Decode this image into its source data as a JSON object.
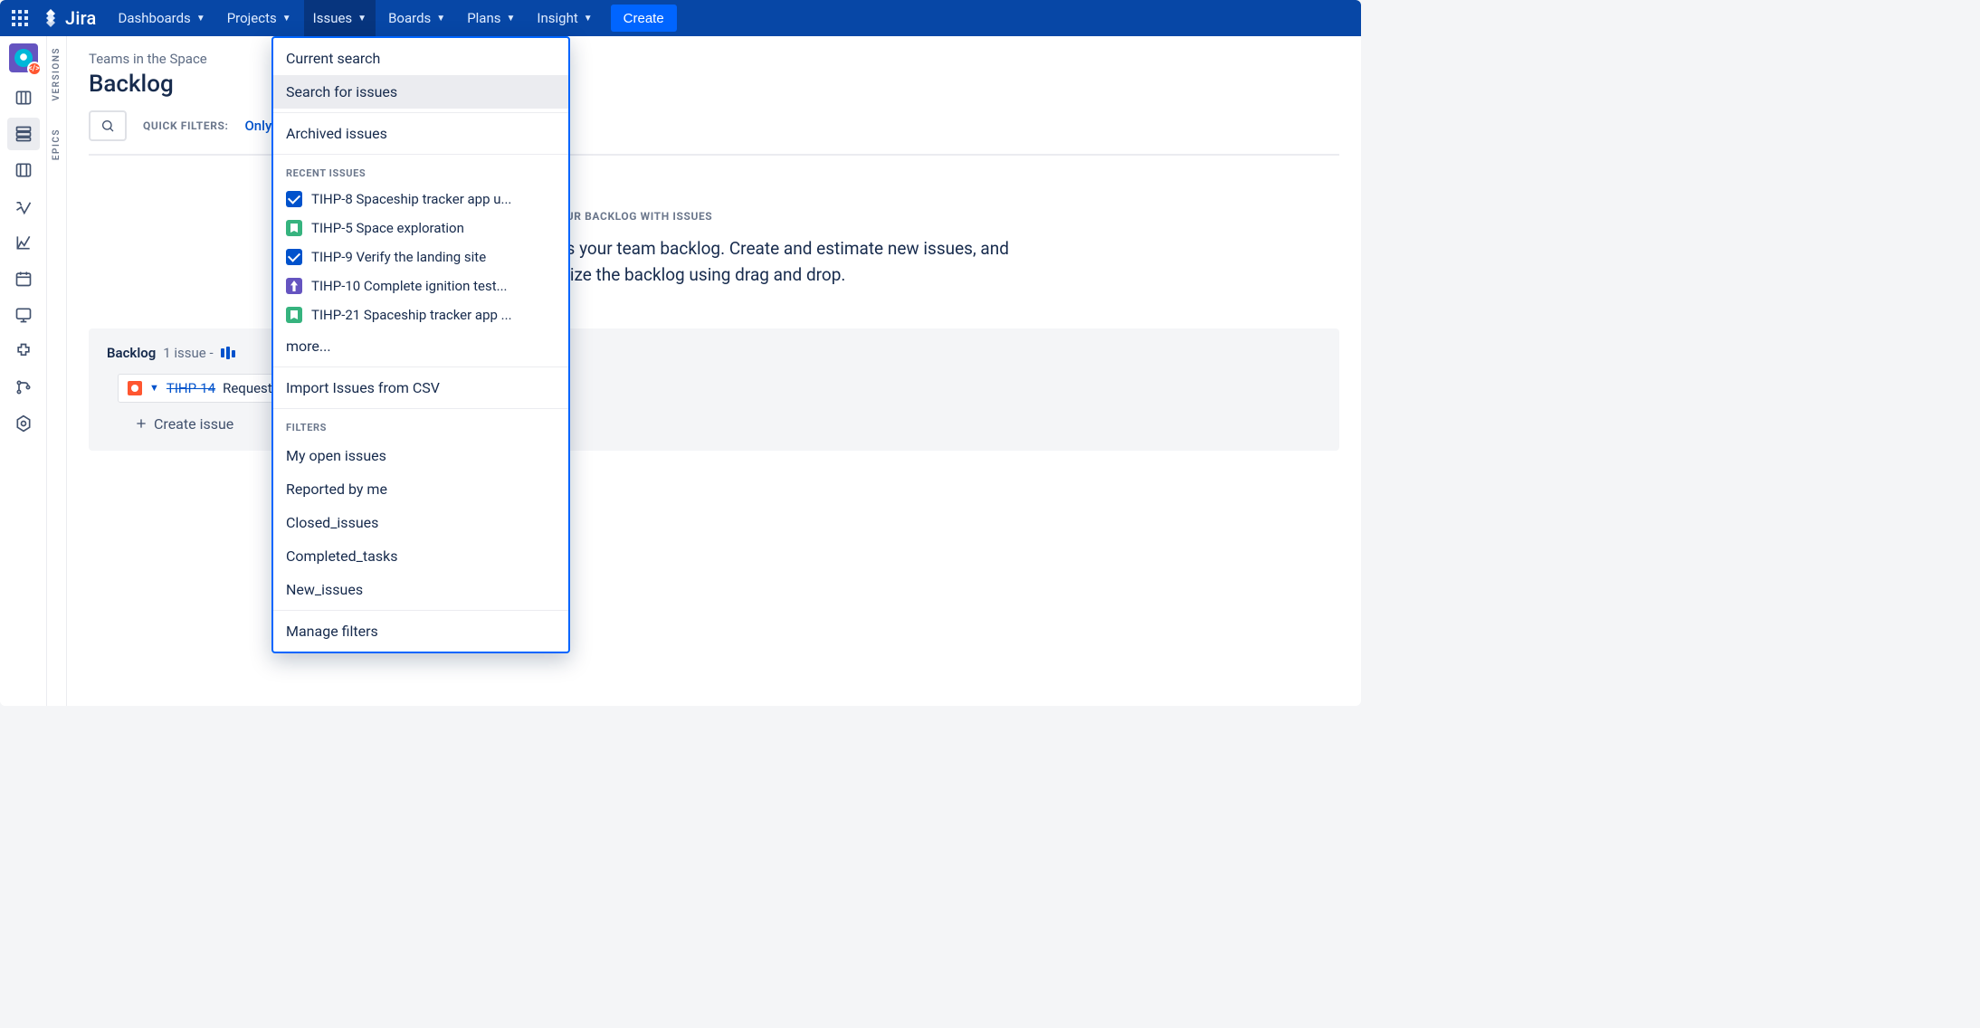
{
  "brand": {
    "name": "Jira"
  },
  "topnav": {
    "items": [
      {
        "label": "Dashboards"
      },
      {
        "label": "Projects"
      },
      {
        "label": "Issues",
        "active": true
      },
      {
        "label": "Boards"
      },
      {
        "label": "Plans"
      },
      {
        "label": "Insight"
      }
    ],
    "create_label": "Create"
  },
  "side_rails": {
    "versions": "VERSIONS",
    "epics": "EPICS"
  },
  "header": {
    "breadcrumb": "Teams in the Space",
    "title": "Backlog",
    "quick_filters_label": "QUICK FILTERS:",
    "only_my_issues": "Only My Issues"
  },
  "help": {
    "title": "FILL YOUR BACKLOG WITH ISSUES",
    "body": "This is your team backlog. Create and estimate new issues, and prioritize the backlog using drag and drop."
  },
  "backlog": {
    "section_name": "Backlog",
    "count_text": "1 issue -",
    "issue": {
      "key": "TIHP-14",
      "summary": "Request type isn't"
    },
    "create_issue_label": "Create issue"
  },
  "issues_menu": {
    "current_search": "Current search",
    "search_for_issues": "Search for issues",
    "archived_issues": "Archived issues",
    "recent_heading": "RECENT ISSUES",
    "recent": [
      {
        "type": "task",
        "text": "TIHP-8 Spaceship tracker app u..."
      },
      {
        "type": "story",
        "text": "TIHP-5 Space exploration"
      },
      {
        "type": "task",
        "text": "TIHP-9 Verify the landing site"
      },
      {
        "type": "epic",
        "text": "TIHP-10 Complete ignition test..."
      },
      {
        "type": "story",
        "text": "TIHP-21 Spaceship tracker app ..."
      }
    ],
    "more": "more...",
    "import_csv": "Import Issues from CSV",
    "filters_heading": "FILTERS",
    "filters": [
      "My open issues",
      "Reported by me",
      "Closed_issues",
      "Completed_tasks",
      "New_issues"
    ],
    "manage_filters": "Manage filters"
  },
  "colors": {
    "nav_bg": "#0747A6",
    "accent": "#0065FF",
    "link": "#0052CC"
  }
}
